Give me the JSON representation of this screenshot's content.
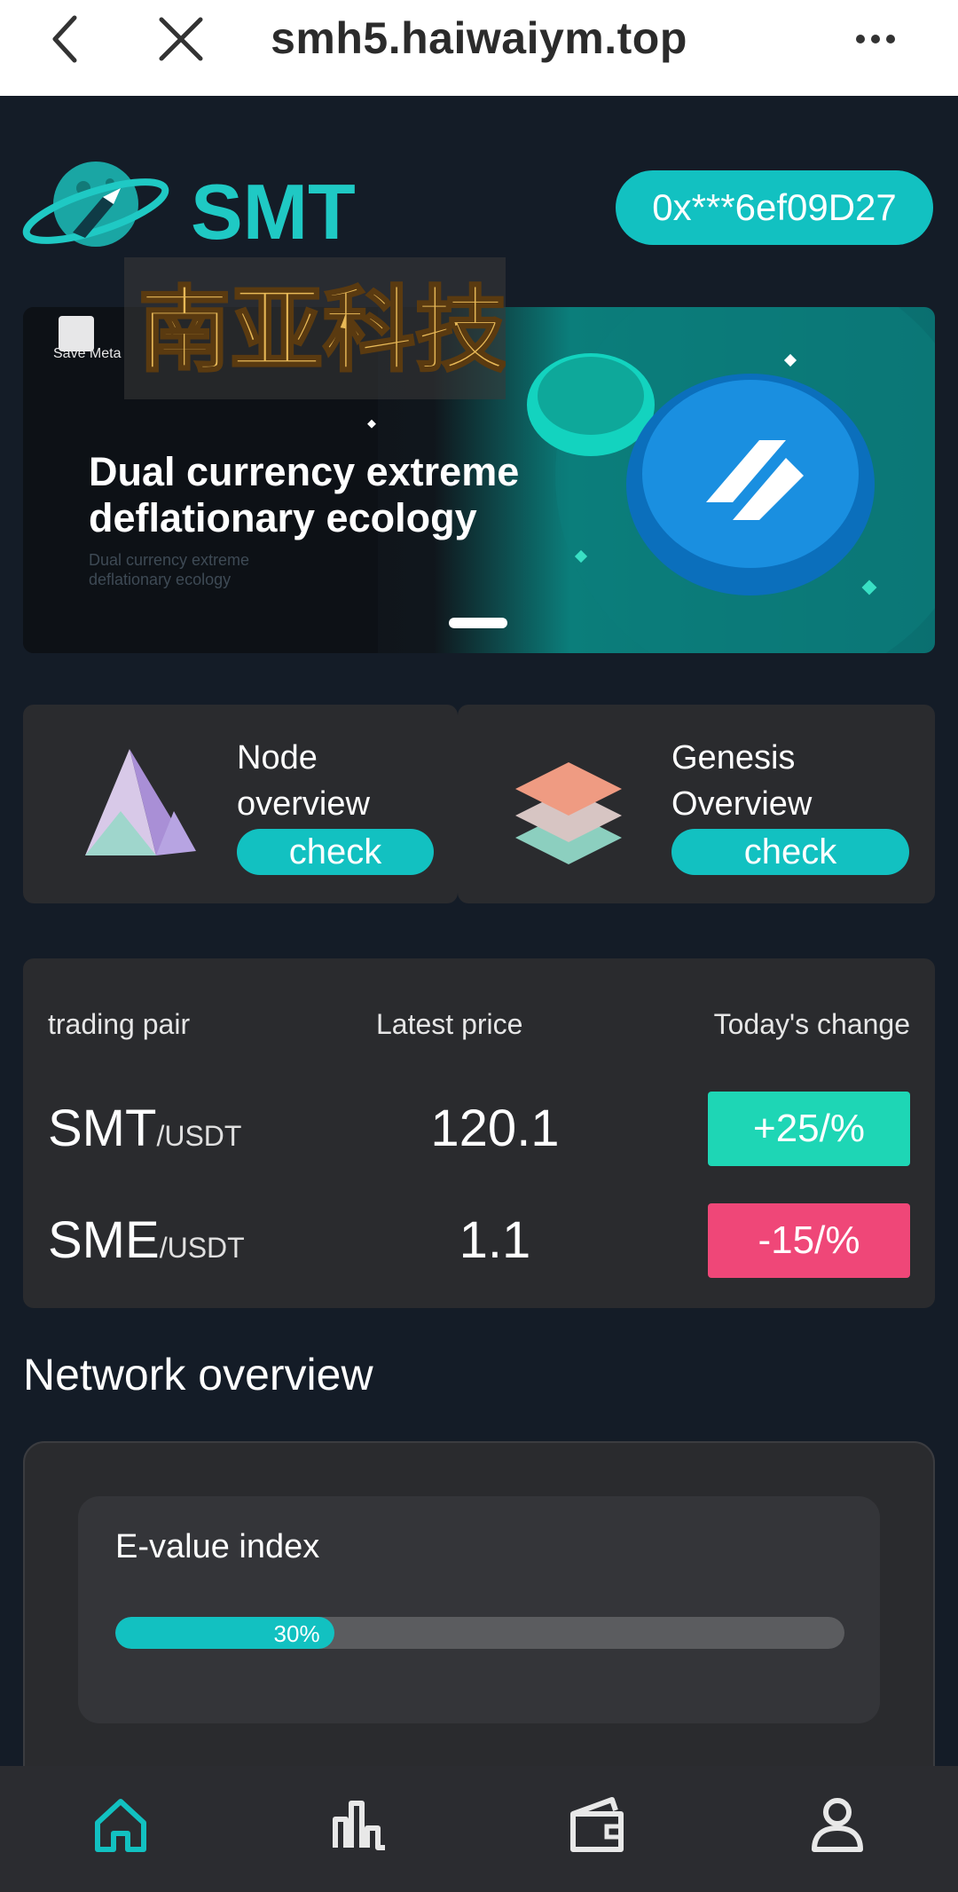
{
  "browser": {
    "url": "smh5.haiwaiym.top",
    "icons": [
      "back-arrow-icon",
      "close-icon",
      "more-icon"
    ]
  },
  "header": {
    "brand": "SMT",
    "wallet_address": "0x***6ef09D27"
  },
  "banner": {
    "brand_small": "Save Meta",
    "title": "Dual currency extreme deflationary ecology",
    "subtitle": "Dual currency extreme deflationary ecology",
    "overlay_text": "南亚科技"
  },
  "cards": [
    {
      "title": "Node overview",
      "button": "check",
      "icon": "node-pyramid-icon"
    },
    {
      "title": "Genesis Overview",
      "button": "check",
      "icon": "genesis-layers-icon"
    }
  ],
  "market": {
    "headers": {
      "pair": "trading pair",
      "price": "Latest price",
      "change": "Today's change"
    },
    "rows": [
      {
        "base": "SMT",
        "quote": "/USDT",
        "price": "120.1",
        "change": "+25/%",
        "direction": "up"
      },
      {
        "base": "SME",
        "quote": "/USDT",
        "price": "1.1",
        "change": "-15/%",
        "direction": "down"
      }
    ]
  },
  "network": {
    "title": "Network overview",
    "evalue_label": "E-value index",
    "evalue_progress": 0.3,
    "evalue_text": "30%"
  },
  "nav": [
    "home-icon",
    "chart-icon",
    "wallet-icon",
    "user-icon"
  ],
  "colors": {
    "accent": "#12c1c1",
    "up": "#1ed6b5",
    "down": "#ef4778",
    "background": "#141c27",
    "card": "#2a2b2e"
  }
}
